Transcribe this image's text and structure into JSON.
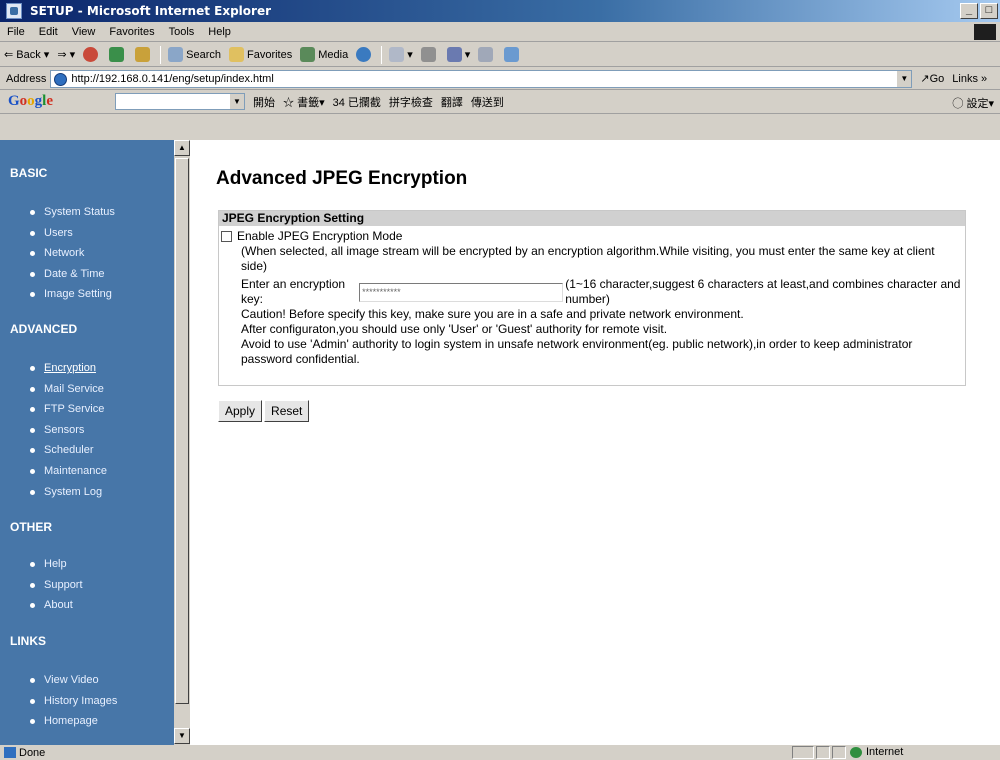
{
  "window": {
    "title": "SETUP - Microsoft Internet Explorer",
    "buttons": {
      "minimize": "-",
      "maximize": "̅"
    }
  },
  "menubar": [
    "File",
    "Edit",
    "View",
    "Favorites",
    "Tools",
    "Help"
  ],
  "toolbar": {
    "back": "Back",
    "search": "Search",
    "favorites": "Favorites",
    "media": "Media"
  },
  "address": {
    "label": "Address",
    "url": "http://192.168.0.141/eng/setup/index.html",
    "go": "Go",
    "links": "Links"
  },
  "googlebar": {
    "start": "開始",
    "bookmarks": "書籤",
    "blocked": "34 已攔截",
    "spellcheck": "拼字檢查",
    "translate": "翻譯",
    "sendto": "傳送到",
    "settings": "設定"
  },
  "sidebar": {
    "sections": [
      {
        "title": "BASIC",
        "items": [
          "System Status",
          "Users",
          "Network",
          "Date & Time",
          "Image Setting"
        ]
      },
      {
        "title": "ADVANCED",
        "items": [
          "Encryption",
          "Mail Service",
          "FTP Service",
          "Sensors",
          "Scheduler",
          "Maintenance",
          "System Log"
        ]
      },
      {
        "title": "OTHER",
        "items": [
          "Help",
          "Support",
          "About"
        ]
      },
      {
        "title": "LINKS",
        "items": [
          "View Video",
          "History Images",
          "Homepage"
        ]
      }
    ],
    "active": "Encryption"
  },
  "main": {
    "title": "Advanced JPEG Encryption",
    "panel": {
      "heading": "JPEG Encryption Setting",
      "enable_label": "Enable JPEG Encryption Mode",
      "enable_checked": false,
      "enable_note": "(When selected, all image stream will be encrypted by an encryption algorithm.While visiting, you must enter the same key at client side)",
      "key_label": "Enter an encryption key:",
      "key_value": "***********",
      "key_hint": "(1~16 character,suggest 6 characters at least,and combines character and number)",
      "caution": "Caution! Before specify this key, make sure you are in a safe and private network environment.",
      "after_config": "After configuraton,you should use only 'User' or 'Guest' authority for remote visit.",
      "avoid": "Avoid to use 'Admin' authority to login system in unsafe network environment(eg. public network),in order to keep administrator password confidential."
    },
    "buttons": {
      "apply": "Apply",
      "reset": "Reset"
    }
  },
  "statusbar": {
    "left": "Done",
    "zone": "Internet"
  }
}
